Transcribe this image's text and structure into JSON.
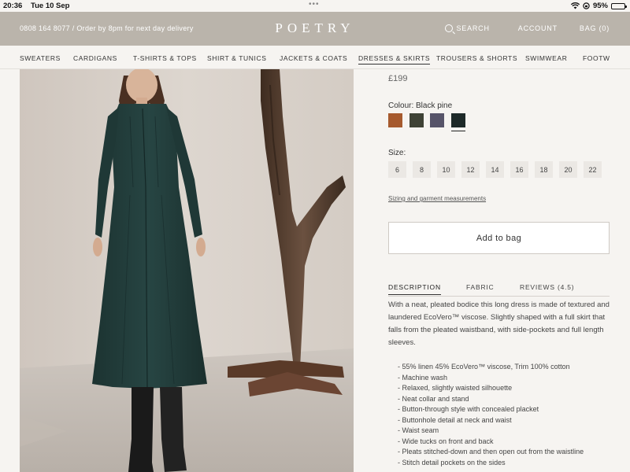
{
  "status_bar": {
    "time": "20:36",
    "date": "Tue 10 Sep",
    "battery": "95%",
    "battery_level": 0.95,
    "icons": [
      "wifi-icon",
      "orientation-lock-icon",
      "battery-icon"
    ]
  },
  "header": {
    "promo": "0808 164 8077 / Order by 8pm for next day delivery",
    "logo": "POETRY",
    "search_label": "SEARCH",
    "account_label": "ACCOUNT",
    "bag_label": "BAG (0)",
    "background": "#bab4ab"
  },
  "categories": [
    {
      "label": "SWEATERS"
    },
    {
      "label": "CARDIGANS"
    },
    {
      "label": "T-SHIRTS & TOPS"
    },
    {
      "label": "SHIRT & TUNICS"
    },
    {
      "label": "JACKETS & COATS"
    },
    {
      "label": "DRESSES & SKIRTS"
    },
    {
      "label": "TROUSERS & SHORTS"
    },
    {
      "label": "SWIMWEAR"
    },
    {
      "label": "FOOTW"
    }
  ],
  "active_category": "DRESSES & SKIRTS",
  "product": {
    "price": "£199",
    "colour_label": "Colour: Black pine",
    "swatches": [
      {
        "name": "rust",
        "color": "#a65a2e"
      },
      {
        "name": "olive",
        "color": "#3f4236"
      },
      {
        "name": "slate",
        "color": "#575469"
      },
      {
        "name": "black-pine",
        "color": "#1e2a29",
        "selected": true
      }
    ],
    "size_label": "Size:",
    "sizes": [
      "6",
      "8",
      "10",
      "12",
      "14",
      "16",
      "18",
      "20",
      "22"
    ],
    "sizing_link": "Sizing and garment measurements",
    "add_to_bag": "Add to bag",
    "tabs": [
      "DESCRIPTION",
      "FABRIC",
      "REVIEWS (4.5)"
    ],
    "description": "With a neat, pleated bodice this long dress is made of textured and laundered EcoVero™ viscose. Slightly shaped with a full skirt that falls from the pleated waistband, with side-pockets and full length sleeves.",
    "details": [
      "55% linen 45% EcoVero™ viscose, Trim 100% cotton",
      "Machine wash",
      "Relaxed, slightly waisted silhouette",
      "Neat collar and stand",
      "Button-through style with concealed placket",
      "Buttonhole detail at neck and waist",
      "Waist seam",
      "Wide tucks on front and back",
      "Pleats stitched-down and then open out from the waistline",
      "Stitch detail pockets on the sides"
    ]
  }
}
